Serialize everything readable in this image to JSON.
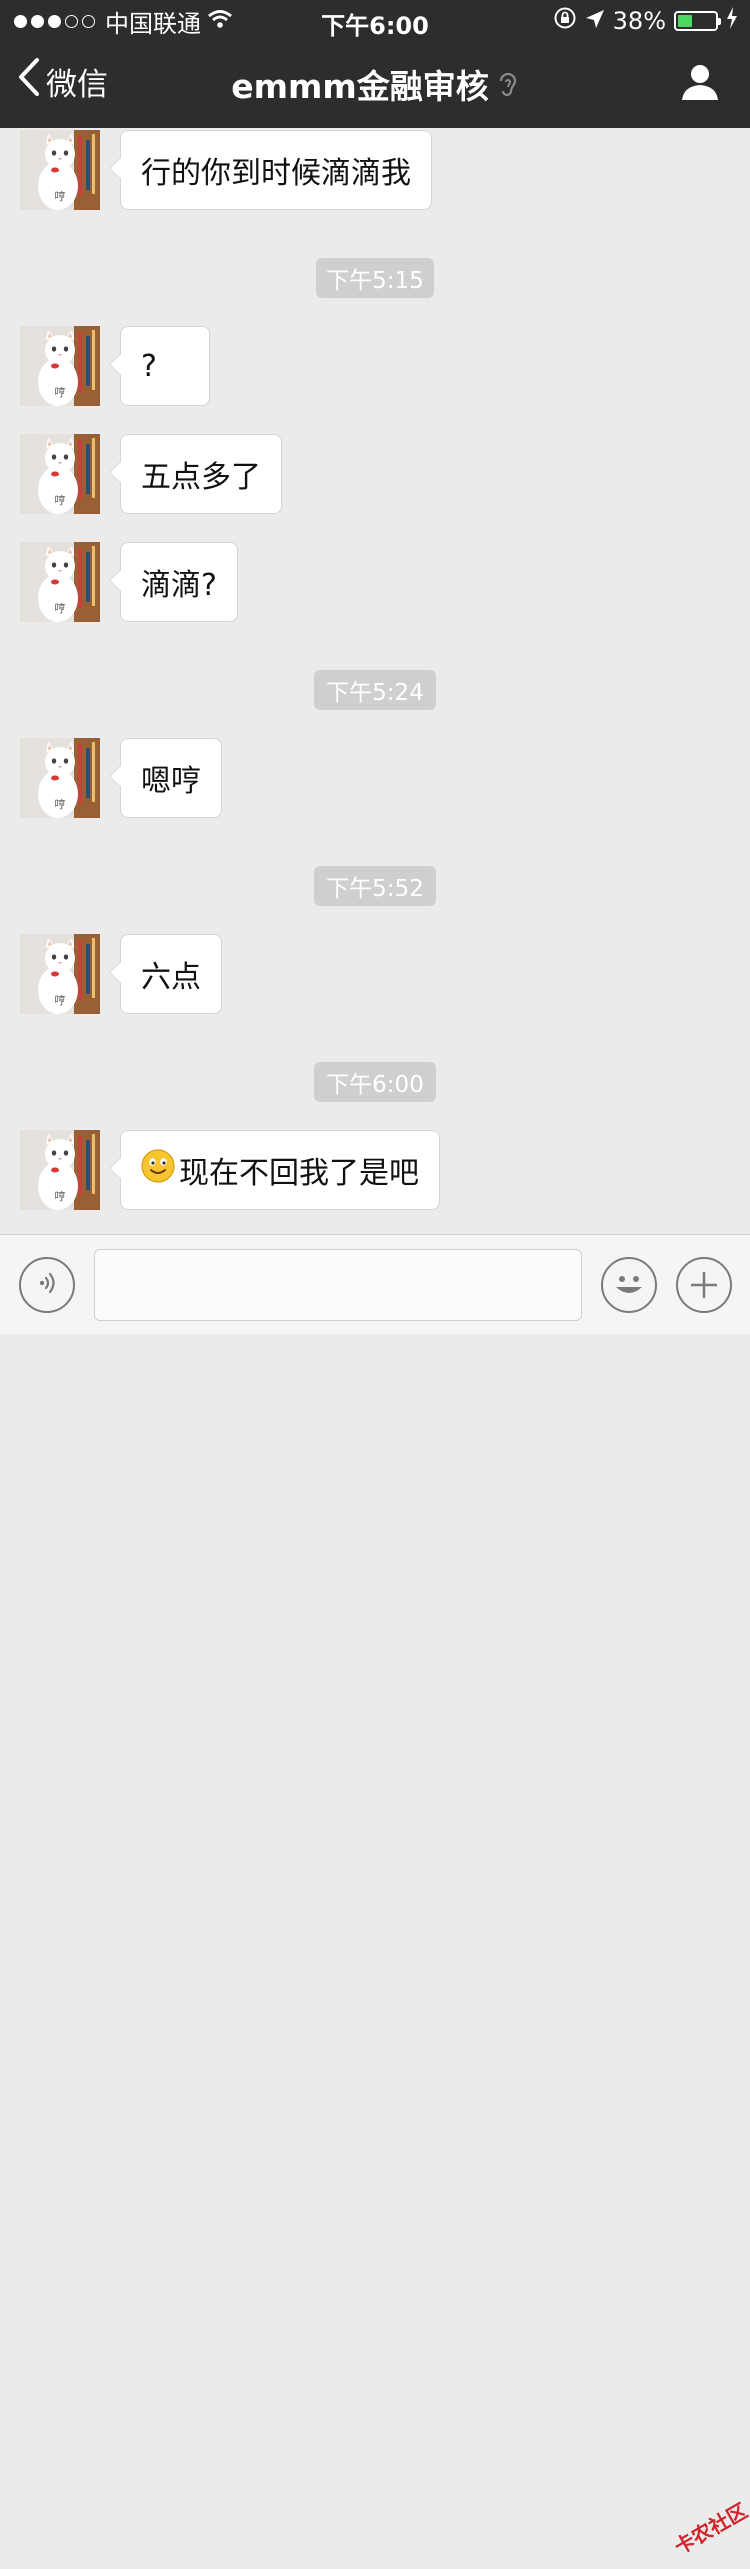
{
  "status_bar": {
    "carrier": "中国联通",
    "time": "下午6:00",
    "battery_percent": "38%",
    "battery_level": 0.38,
    "signal_bars_filled": 3,
    "signal_bars_total": 5
  },
  "nav": {
    "back_label": "微信",
    "title": "emmm金融审核"
  },
  "avatar_caption": "哼",
  "messages": [
    {
      "type": "text",
      "text": "行的你到时候滴滴我"
    },
    {
      "type": "time",
      "text": "下午5:15"
    },
    {
      "type": "text",
      "text": "?"
    },
    {
      "type": "text",
      "text": "五点多了"
    },
    {
      "type": "text",
      "text": "滴滴?"
    },
    {
      "type": "time",
      "text": "下午5:24"
    },
    {
      "type": "text",
      "text": "嗯哼"
    },
    {
      "type": "time",
      "text": "下午5:52"
    },
    {
      "type": "text",
      "text": "六点"
    },
    {
      "type": "time",
      "text": "下午6:00"
    },
    {
      "type": "text",
      "text": "现在不回我了是吧",
      "emoji": "smile-emoji"
    }
  ],
  "input_bar": {
    "input_value": "",
    "input_placeholder": ""
  },
  "watermark_text": "卡农社区",
  "colors": {
    "header_bg": "#2b2d2f",
    "chat_bg": "#ebebeb",
    "timestamp_bg": "#cfcfcf",
    "battery_green": "#4cd964"
  },
  "icons": [
    "back-chevron-icon",
    "ear-icon",
    "profile-icon",
    "voice-icon",
    "emoji-icon",
    "plus-icon",
    "wifi-icon",
    "lock-rotation-icon",
    "location-arrow-icon",
    "charging-icon"
  ]
}
